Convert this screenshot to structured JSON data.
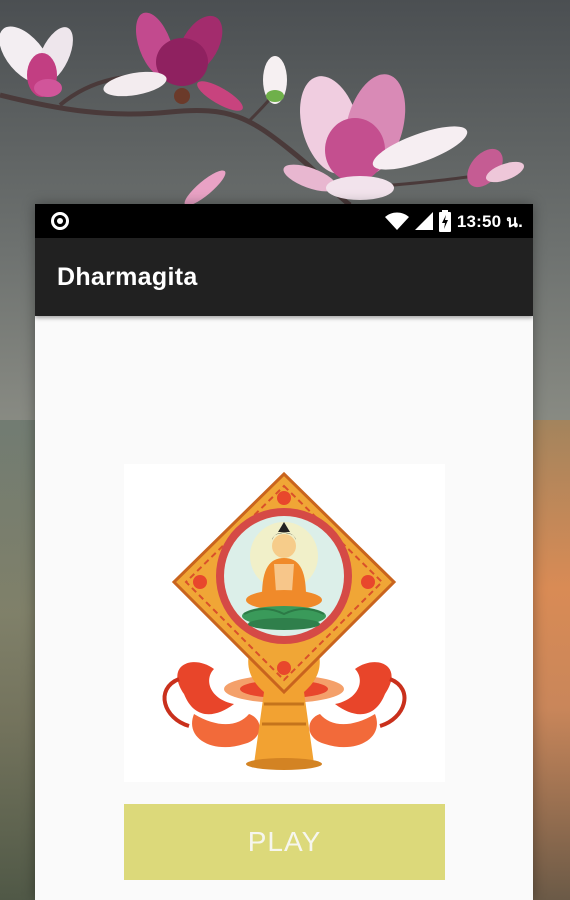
{
  "status_bar": {
    "time": "13:50 น."
  },
  "app_bar": {
    "title": "Dharmagita"
  },
  "main": {
    "play_label": "PLAY"
  },
  "colors": {
    "app_bar": "#212121",
    "status_bar": "#000000",
    "play_button": "#dcd97a",
    "content_bg": "#fafafa"
  }
}
